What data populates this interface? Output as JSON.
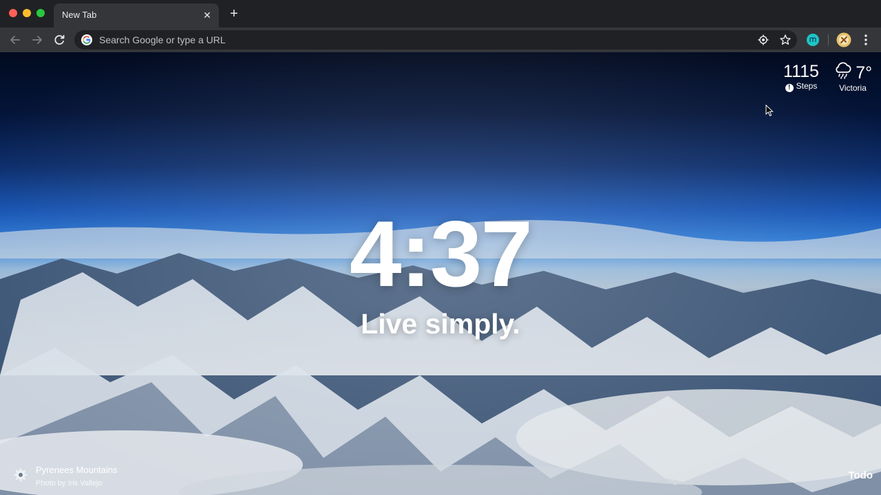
{
  "browser": {
    "tab": {
      "title": "New Tab",
      "close_icon": "close-icon"
    },
    "new_tab_icon": "plus-icon",
    "omnibox": {
      "placeholder": "Search Google or type a URL",
      "value": ""
    },
    "colors": {
      "chrome": "#202124",
      "toolbar": "#35363a",
      "accent_ext": "#1ec6c6"
    }
  },
  "widgets": {
    "steps": {
      "count": "1115",
      "label": "Steps"
    },
    "weather": {
      "temp": "7°",
      "city": "Victoria",
      "icon": "rain-cloud-icon"
    }
  },
  "center": {
    "time": "4:37",
    "mantra": "Live simply."
  },
  "footer": {
    "photo_title": "Pyrenees Mountains",
    "photo_credit": "Photo by Iris Vallejo",
    "todo_label": "Todo"
  }
}
